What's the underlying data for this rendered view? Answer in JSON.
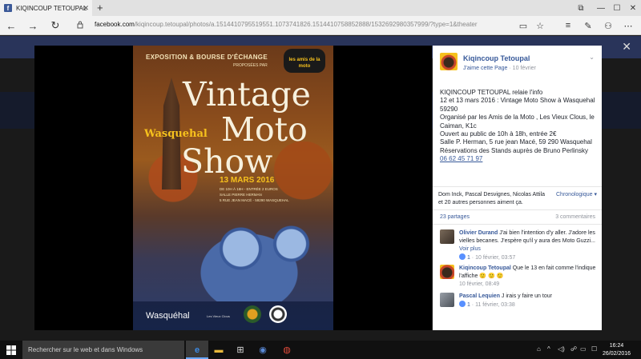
{
  "browser": {
    "tab_title": "KIQINCOUP TETOUPAL",
    "url_host": "facebook.com",
    "url_path": "/kiqincoup.tetoupal/photos/a.1514410795519551.1073741826.1514410758852888/1532692980357999/?type=1&theater"
  },
  "poster": {
    "top_line": "EXPOSITION & BOURSE D'ÉCHANGE",
    "sub_line": "PROPOSÉES PAR",
    "logo_text": "les amis de la moto",
    "title_1": "Vintage",
    "town": "Wasquehal",
    "title_2": "Moto",
    "title_3": "Show",
    "date": "13 MARS 2016",
    "hours": "DE 10H À 18H - ENTRÉE 2 EUROS\nSALLE PIERRE HERMAN\n5 RUE JEAN MACÉ - 59290 WASQUEHAL",
    "footer_logo": "Wasquéhal",
    "footer_logo_2": "Les Vieux Clous"
  },
  "post": {
    "page_name": "Kiqincoup Tetoupal",
    "like_page": "J'aime cette Page",
    "date": "10 février",
    "text": "KIQINCOUP TETOUPAL relaie l'info\n12 et 13 mars 2016 : Vintage Moto Show à Wasquehal 59290\nOrganisé par les Amis de la Moto , Les Vieux Clous, le Caiman, K1c\nOuvert au public de 10h à 18h, entrée 2€\nSalle P. Herman, 5 rue jean Macé, 59 290 Wasquehal\nRéservations des Stands auprès de Bruno Perlinsky ",
    "phone": "06 62 45 71 97",
    "likers": "Dom Inck, Pascal Desvignes, Nicolas Attila et 20 autres personnes aiment ça.",
    "chrono": "Chronologique ▾",
    "shares": "23 partages",
    "comments_count": "3 commentaires"
  },
  "comments": [
    {
      "author": "Olivier Durand",
      "text": "J'ai bien l'intention d'y aller. J'adore les vielles becanes. J'espère qu'il y aura des Moto Guzzi...",
      "more": "Voir plus",
      "likes": "1",
      "time": "10 février, 03:57"
    },
    {
      "author": "Kiqincoup Tetoupal",
      "text": "Que le 13 en fait comme l'indique l'affiche 🙂 🙂 🙂",
      "time": "10 février, 08:49"
    },
    {
      "author": "Pascal Lequien",
      "text": "J irais y faire un tour",
      "likes": "1",
      "time": "11 février, 03:38"
    }
  ],
  "taskbar": {
    "search_placeholder": "Rechercher sur le web et dans Windows",
    "time": "16:24",
    "date": "26/02/2016"
  }
}
